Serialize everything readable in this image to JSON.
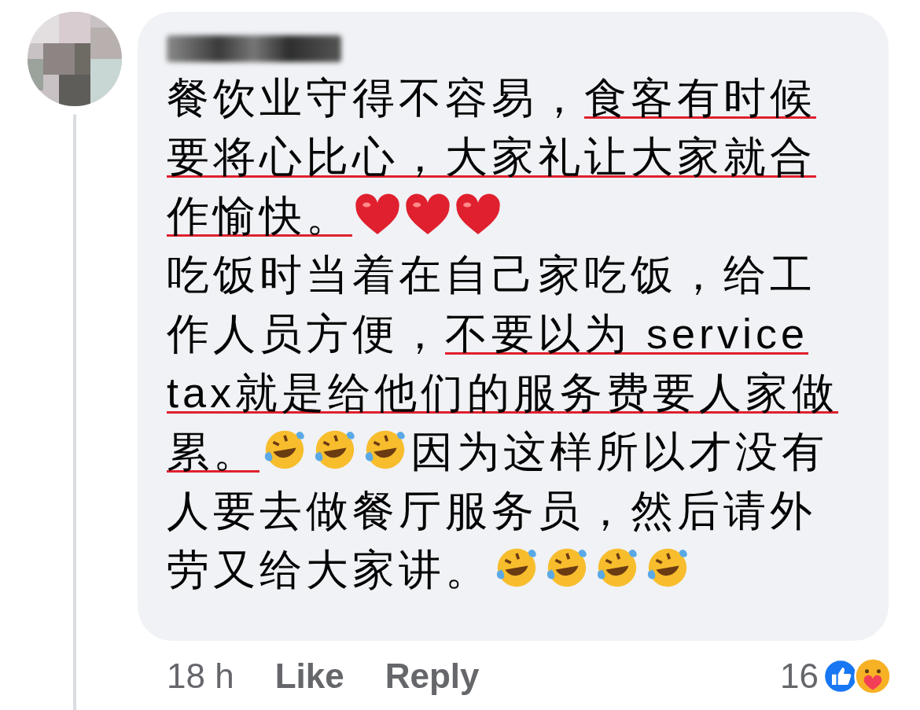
{
  "comment": {
    "paragraphs": [
      [
        {
          "kind": "text",
          "text": "餐饮业守得不容易，",
          "underlined": false
        },
        {
          "kind": "text",
          "text": "食客有时候要将心比心，大家礼让大家就合作愉快。",
          "underlined": true
        },
        {
          "kind": "heart"
        },
        {
          "kind": "heart"
        },
        {
          "kind": "heart"
        }
      ],
      [
        {
          "kind": "text",
          "text": "吃饭时当着在自己家吃饭，给工作人员方便，",
          "underlined": false
        },
        {
          "kind": "text",
          "text": "不要以为 service tax就是给他们的服务费要人家做累。",
          "underlined": true
        },
        {
          "kind": "laugh"
        },
        {
          "kind": "laugh"
        },
        {
          "kind": "laugh"
        },
        {
          "kind": "text",
          "text": "因为这样所以才没有人要去做餐厅服务员，然后请外劳又给大家讲。",
          "underlined": false
        },
        {
          "kind": "laugh"
        },
        {
          "kind": "laugh"
        },
        {
          "kind": "laugh"
        },
        {
          "kind": "laugh"
        }
      ]
    ]
  },
  "footer": {
    "time": "18 h",
    "actions": [
      "Like",
      "Reply"
    ],
    "reaction_count": "16"
  }
}
